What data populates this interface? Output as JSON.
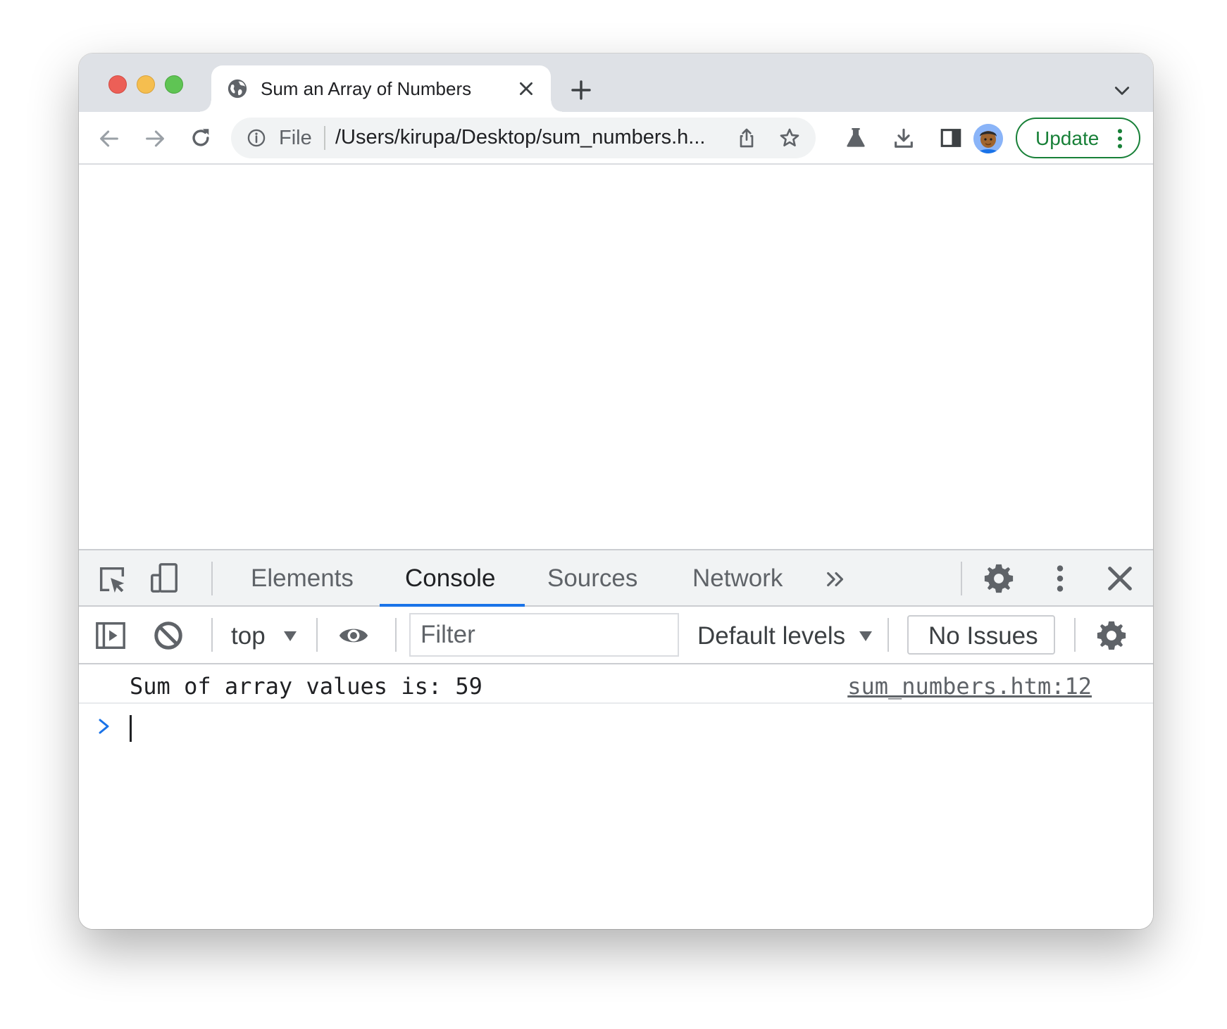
{
  "window": {
    "background": "#ffffff"
  },
  "tab": {
    "title": "Sum an Array of Numbers",
    "favicon": "globe-icon"
  },
  "toolbar": {
    "omnibox": {
      "scheme_label": "File",
      "url": "/Users/kirupa/Desktop/sum_numbers.h..."
    },
    "update_label": "Update",
    "accent_color": "#188038"
  },
  "devtools": {
    "tabs": [
      {
        "label": "Elements",
        "active": false
      },
      {
        "label": "Console",
        "active": true
      },
      {
        "label": "Sources",
        "active": false
      },
      {
        "label": "Network",
        "active": false
      }
    ],
    "active_color": "#1a73e8",
    "console_bar": {
      "context": "top",
      "filter_placeholder": "Filter",
      "levels": "Default levels",
      "issues": "No Issues"
    },
    "messages": [
      {
        "text": "Sum of array values is: 59",
        "source": "sum_numbers.htm:12"
      }
    ]
  }
}
